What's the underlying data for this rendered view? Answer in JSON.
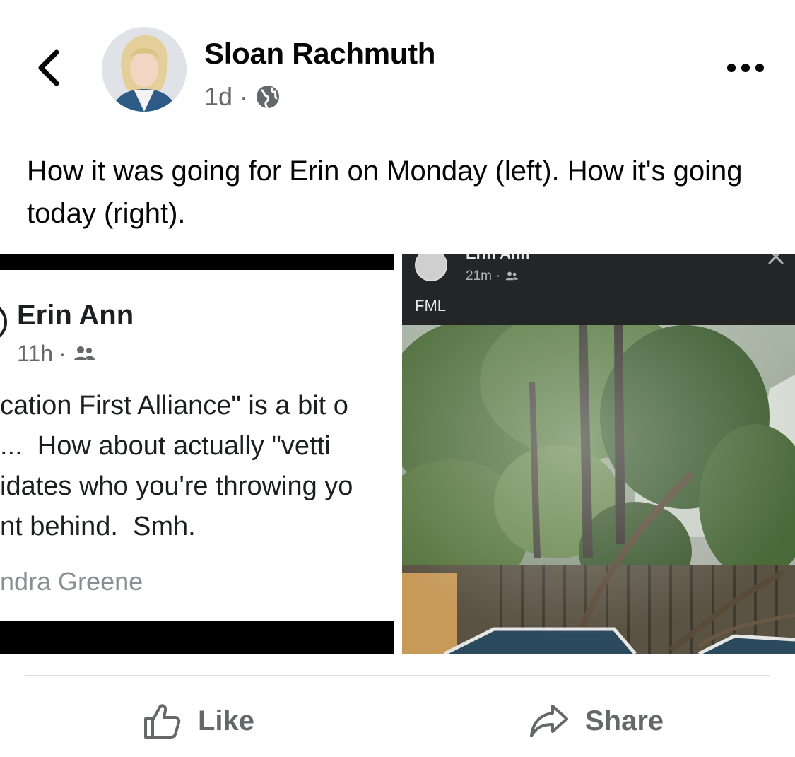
{
  "post": {
    "author": "Sloan Rachmuth",
    "time": "1d",
    "separator": "·",
    "privacy_icon": "globe-icon",
    "caption": "How it was going for Erin on Monday (left). How it's going today (right)."
  },
  "left_screenshot": {
    "name": "Erin Ann",
    "time": "11h",
    "separator": "·",
    "audience_icon": "friends-icon",
    "text": "cation First Alliance\" is a bit o\n...  How about actually \"vetti\nidates who you're throwing yo\nnt behind.  Smh.",
    "signature": "ndra Greene"
  },
  "right_screenshot": {
    "name": "Erin Ann",
    "time": "21m",
    "separator": "·",
    "audience_icon": "friends-icon",
    "text": "FML",
    "photo_description_icon": "photo-fallen-tree"
  },
  "actions": {
    "like": "Like",
    "share": "Share"
  },
  "colors": {
    "text_primary": "#050505",
    "text_secondary": "#65676b",
    "divider": "#dadde1",
    "dark_header": "#242526"
  }
}
